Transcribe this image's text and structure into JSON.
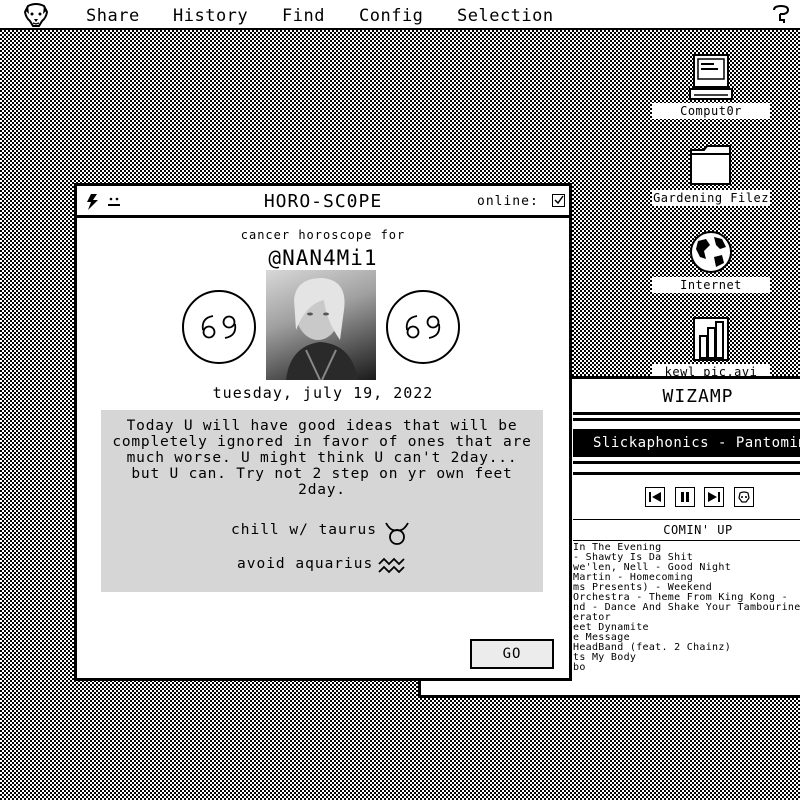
{
  "menubar": {
    "logo_icon": "dog-face-icon",
    "items": [
      "Share",
      "History",
      "Find",
      "Config",
      "Selection"
    ],
    "right_icon": "help-icon"
  },
  "desktop": {
    "icons": [
      {
        "label": "Comput0r",
        "icon": "computer-icon"
      },
      {
        "label": "Gardening Filez",
        "icon": "folder-icon"
      },
      {
        "label": "Internet",
        "icon": "globe-icon"
      },
      {
        "label": "kewl pic.avi",
        "icon": "video-file-icon"
      }
    ]
  },
  "horoscope": {
    "title": "HORO-SC0PE",
    "online_label": "online:",
    "online_checked": "☑",
    "for_label": "cancer horoscope for",
    "handle": "@NAN4Mi1",
    "sign_glyph": "♋",
    "date": "tuesday, july 19, 2022",
    "reading": "Today U will have good ideas that will be completely ignored in favor of ones that are much worse. U might think U can't 2day... but U can. Try not 2 step on yr own feet 2day.",
    "compat_label": "chill w/ taurus",
    "compat_glyph": "♉",
    "avoid_label": "avoid aquarius",
    "avoid_glyph": "♒",
    "go_label": "GO"
  },
  "wizamp": {
    "title": "WIZAMP",
    "now_playing": "Slickaphonics - Pantomime",
    "up_next_label": "COMIN' UP",
    "playlist": [
      "In The Evening",
      "- Shawty Is Da Shit",
      "we'len, Nell - Good Night",
      "Martin - Homecoming",
      "ms Presents) - Weekend",
      "Orchestra - Theme From King Kong -",
      "nd - Dance And Shake Your Tambourine",
      "erator",
      "eet Dynamite",
      "e Message",
      "HeadBand (feat. 2 Chainz)",
      "ts My Body",
      "bo"
    ]
  }
}
